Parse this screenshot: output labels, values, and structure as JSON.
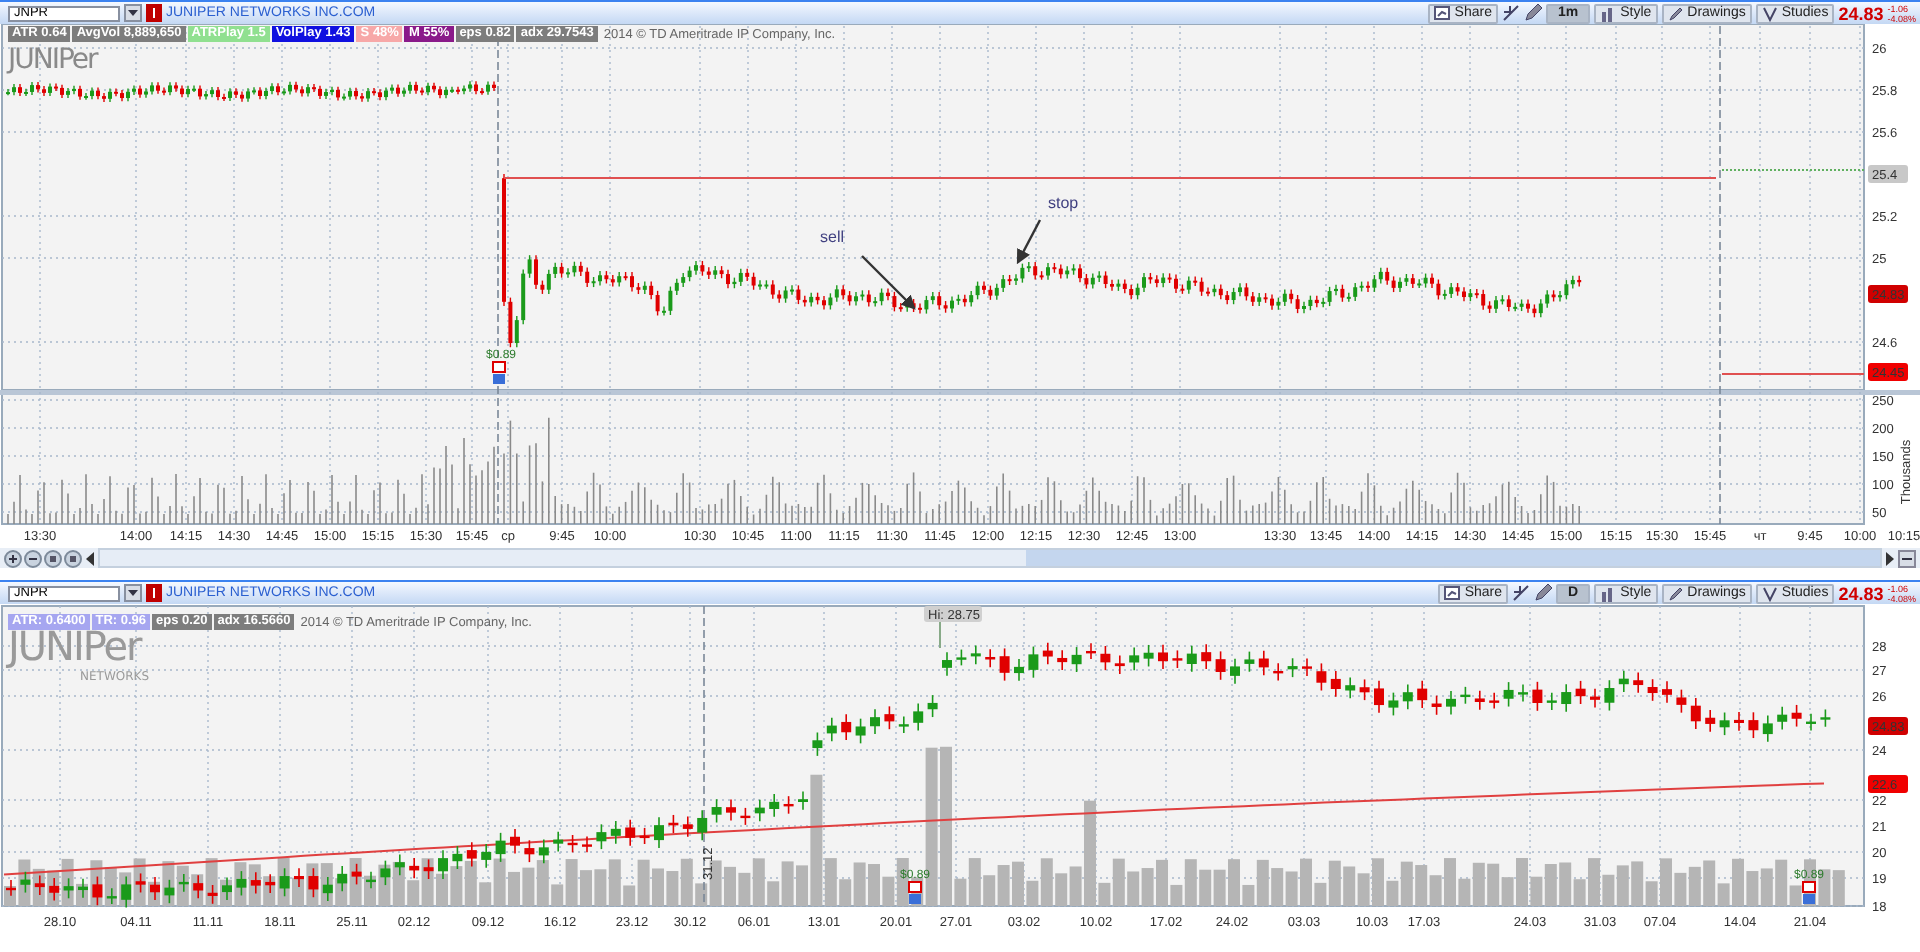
{
  "panes": [
    {
      "kind": "intraday",
      "symbol": "JNPR",
      "company": "JUNIPER NETWORKS INC.COM",
      "share": "Share",
      "interval": "1m",
      "style": "Style",
      "drawings": "Drawings",
      "studies": "Studies",
      "price": "24.83",
      "change": "-1.06",
      "change_pct": "-4.08%",
      "badges": [
        {
          "text": "ATR 0.64",
          "color": "#7d7d7d"
        },
        {
          "text": "AvgVol 8,889,650",
          "color": "#7d7d7d"
        },
        {
          "text": "ATRPlay 1.5",
          "color": "#90e090"
        },
        {
          "text": "VolPlay 1.43",
          "color": "#1010e0"
        },
        {
          "text": "S 48%",
          "color": "#f7a8a8"
        },
        {
          "text": "M 55%",
          "color": "#8a1a8a"
        },
        {
          "text": "eps 0.82",
          "color": "#7d7d7d"
        },
        {
          "text": "adx 29.7543",
          "color": "#7d7d7d"
        }
      ],
      "copyright": "2014 © TD Ameritrade IP Company, Inc.",
      "logo": "JUNIPer",
      "y_ticks": [
        "26",
        "25.8",
        "25.6",
        "25.2",
        "25",
        "24.6"
      ],
      "price_labels": [
        {
          "text": "25.4",
          "kind": "level"
        },
        {
          "text": "24.83",
          "kind": "last"
        },
        {
          "text": "24.45",
          "kind": "stop"
        }
      ],
      "volume_ticks": [
        "250",
        "200",
        "150",
        "100",
        "50"
      ],
      "volume_unit": "Thousands",
      "x_labels": [
        "13:30",
        "14:00",
        "14:15",
        "14:30",
        "14:45",
        "15:00",
        "15:15",
        "15:30",
        "15:45",
        "ср",
        "9:45",
        "10:00",
        "10:30",
        "10:45",
        "11:00",
        "11:15",
        "11:30",
        "11:45",
        "12:00",
        "12:15",
        "12:30",
        "12:45",
        "13:00",
        "13:30",
        "13:45",
        "14:00",
        "14:15",
        "14:30",
        "14:45",
        "15:00",
        "15:15",
        "15:30",
        "15:45",
        "чт",
        "9:45",
        "10:00",
        "10:15"
      ],
      "annotations": [
        {
          "text": "sell"
        },
        {
          "text": "stop"
        }
      ],
      "events": [
        {
          "text": "$0.89"
        }
      ]
    },
    {
      "kind": "daily",
      "symbol": "JNPR",
      "company": "JUNIPER NETWORKS INC.COM",
      "share": "Share",
      "interval": "D",
      "style": "Style",
      "drawings": "Drawings",
      "studies": "Studies",
      "price": "24.83",
      "change": "-1.06",
      "change_pct": "-4.08%",
      "badges": [
        {
          "text": "ATR: 0.6400",
          "color": "#a6a6f0"
        },
        {
          "text": "TR: 0.96",
          "color": "#a6a6f0"
        },
        {
          "text": "eps 0.20",
          "color": "#7d7d7d"
        },
        {
          "text": "adx 16.5660",
          "color": "#7d7d7d"
        }
      ],
      "copyright": "2014 © TD Ameritrade IP Company, Inc.",
      "logo": "JUNIPer",
      "logo_sub": "NETWORKS",
      "y_ticks": [
        "28",
        "27",
        "26",
        "24",
        "22",
        "21",
        "20",
        "19",
        "18"
      ],
      "price_labels": [
        {
          "text": "24.83",
          "kind": "last"
        },
        {
          "text": "22.6",
          "kind": "average"
        }
      ],
      "high_label": "Hi: 28.75",
      "date_marker": "31.12",
      "x_labels": [
        "28.10",
        "04.11",
        "11.11",
        "18.11",
        "25.11",
        "02.12",
        "09.12",
        "16.12",
        "23.12",
        "30.12",
        "06.01",
        "13.01",
        "20.01",
        "27.01",
        "03.02",
        "10.02",
        "17.02",
        "24.02",
        "03.03",
        "10.03",
        "17.03",
        "24.03",
        "31.03",
        "07.04",
        "14.04",
        "21.04"
      ],
      "events": [
        {
          "text": "$0.89"
        },
        {
          "text": "$0.89"
        }
      ]
    }
  ]
}
